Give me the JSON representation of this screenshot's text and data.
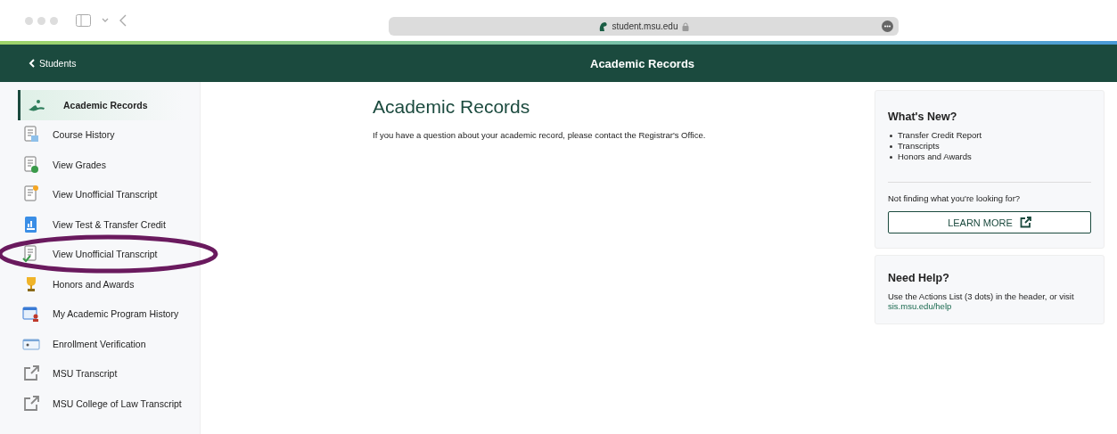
{
  "browser": {
    "address": "student.msu.edu"
  },
  "header": {
    "back": "Students",
    "title": "Academic Records"
  },
  "sidebar": {
    "items": [
      {
        "label": "Academic Records",
        "kind": "records",
        "selected": true,
        "circled": false
      },
      {
        "label": "Course History",
        "kind": "table-doc",
        "selected": false,
        "circled": false
      },
      {
        "label": "View Grades",
        "kind": "grade-doc",
        "selected": false,
        "circled": false
      },
      {
        "label": "View Unofficial Transcript",
        "kind": "star-doc",
        "selected": false,
        "circled": false
      },
      {
        "label": "View Test & Transfer Credit",
        "kind": "chart-doc",
        "selected": false,
        "circled": false
      },
      {
        "label": "View Unofficial Transcript",
        "kind": "check-doc",
        "selected": false,
        "circled": true
      },
      {
        "label": "Honors and Awards",
        "kind": "trophy",
        "selected": false,
        "circled": false
      },
      {
        "label": "My Academic Program History",
        "kind": "calendar",
        "selected": false,
        "circled": false
      },
      {
        "label": "Enrollment Verification",
        "kind": "card",
        "selected": false,
        "circled": false
      },
      {
        "label": "MSU Transcript",
        "kind": "external",
        "selected": false,
        "circled": false
      },
      {
        "label": "MSU College of Law Transcript",
        "kind": "external",
        "selected": false,
        "circled": false
      }
    ]
  },
  "main": {
    "title": "Academic Records",
    "text": "If you have a question about your academic record, please contact the Registrar's Office."
  },
  "whats_new": {
    "title": "What's New?",
    "items": [
      "Transfer Credit Report",
      "Transcripts",
      "Honors and Awards"
    ],
    "prompt": "Not finding what you're looking for?",
    "button": "LEARN MORE"
  },
  "help": {
    "title": "Need Help?",
    "text": "Use the Actions List (3 dots) in the header, or visit",
    "link": "sis.msu.edu/help"
  }
}
